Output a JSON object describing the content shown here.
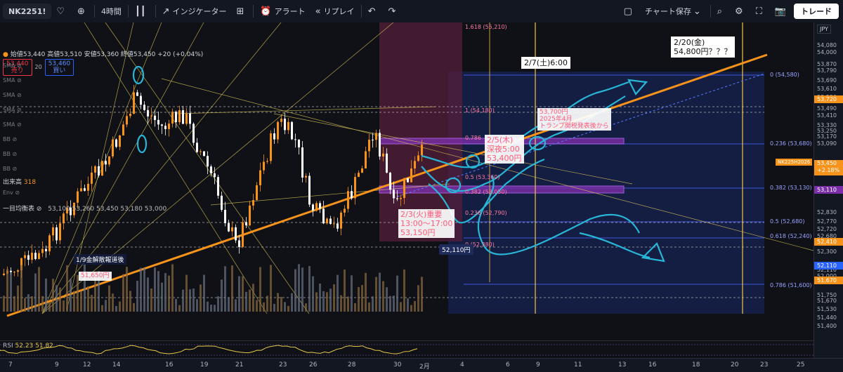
{
  "toolbar": {
    "symbol": "NK2251!",
    "interval": "4時間",
    "indicators_label": "インジケーター",
    "alert_label": "アラート",
    "replay_label": "リプレイ",
    "save_label": "チャート保存",
    "trade_label": "トレード"
  },
  "legend": {
    "ohlc_text": "始値53,440 高値53,510 安値53,360 終値53,450 +20 (+0.04%)",
    "sell_price": "53,440",
    "sell_label": "売り",
    "spread": "20",
    "buy_price": "53,460",
    "buy_label": "買い",
    "volume_label": "出来高",
    "volume_value": "318",
    "ichimoku_label": "一目均衡表",
    "ichimoku_values": "53,100  53,260  53,450  53,180  53,000",
    "sma_label": "SMA",
    "bb_label": "BB",
    "env_label": "Env",
    "rsi_label": "RSI",
    "rsi_values": "52.23  51.82"
  },
  "price_axis": {
    "currency": "JPY",
    "labels": [
      "54,080",
      "54,000",
      "53,870",
      "53,790",
      "53,690",
      "53,610",
      "53,520",
      "53,490",
      "53,410",
      "53,330",
      "53,250",
      "53,170",
      "53,090",
      "52,830",
      "52,770",
      "52,720",
      "52,680",
      "52,300",
      "52,110",
      "52,000",
      "51,750",
      "51,670",
      "51,530",
      "51,440",
      "51,400"
    ],
    "current_symbol_tag": "NK225H2026",
    "current_price": "53,450",
    "current_change": "+2.18%",
    "tag_53720": "53,720",
    "tag_53110": "53,110",
    "tag_52410": "52,410",
    "tag_52110": "52,110",
    "tag_51670": "51,670"
  },
  "time_axis": {
    "labels": [
      "7",
      "9",
      "12",
      "14",
      "16",
      "19",
      "21",
      "23",
      "26",
      "28",
      "30",
      "2月",
      "4",
      "6",
      "9",
      "11",
      "13",
      "16",
      "18",
      "20",
      "23",
      "25"
    ]
  },
  "fib": {
    "l1618": "1.618 (55,210)",
    "l1": "1 (54,180)",
    "l0786": "0.786",
    "l05_upper": "0.5 (53,360)",
    "l0382_upper": "0.382 (53,050)",
    "l0236_upper": "0.236 (52,790)",
    "l0_lower": "0 (52,380)",
    "r0": "0 (54,580)",
    "r0236": "0.236 (53,680)",
    "r0382": "0.382 (53,130)",
    "r05": "0.5 (52,680)",
    "r0618": "0.618 (52,240)",
    "r0786": "0.786 (51,600)"
  },
  "annotations": {
    "feb20": "2/20(金)",
    "feb20_price": "54,800円？？？",
    "feb7": "2/7(土)6:00",
    "tariff_1": "53,700円",
    "tariff_2": "2025年4月",
    "tariff_3": "トランプ関税発表後から",
    "feb5_1": "2/5(木)",
    "feb5_2": "深夜5:00",
    "feb5_3": "53,400円",
    "feb3_1": "2/3(火)重要",
    "feb3_2": "13:00〜17:00",
    "feb3_3": "53,150円",
    "jan9": "1/9金解散報道後",
    "jan9_price": "51,650円",
    "low_price": "52,110円"
  },
  "colors": {
    "up": "#f7931a",
    "down": "#ffffff",
    "trend": "#f7931a",
    "accent_cyan": "#29b6d6",
    "fib_blue": "#3b55d9"
  }
}
